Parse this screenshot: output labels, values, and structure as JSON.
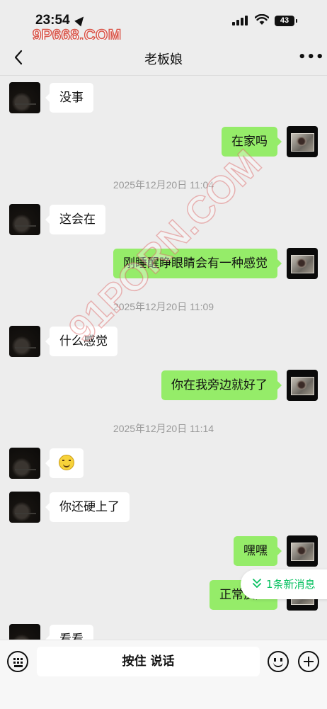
{
  "status_bar": {
    "time": "23:54",
    "battery": "43",
    "watermark": "9P668.COM"
  },
  "header": {
    "title": "老板娘",
    "more_label": "•••"
  },
  "overlay_watermark": "91PORN.COM",
  "messages": [
    {
      "type": "in",
      "text": "没事"
    },
    {
      "type": "out",
      "text": "在家吗"
    },
    {
      "type": "time",
      "text": "2025年12月20日 11:04"
    },
    {
      "type": "in",
      "text": "这会在"
    },
    {
      "type": "out",
      "text": "刚睡醒睁眼睛会有一种感觉"
    },
    {
      "type": "time",
      "text": "2025年12月20日 11:09"
    },
    {
      "type": "in",
      "text": "什么感觉"
    },
    {
      "type": "out",
      "text": "你在我旁边就好了"
    },
    {
      "type": "time",
      "text": "2025年12月20日 11:14"
    },
    {
      "type": "in",
      "emoji": "smile-emoji"
    },
    {
      "type": "in",
      "text": "你还硬上了"
    },
    {
      "type": "out",
      "text": "嘿嘿"
    },
    {
      "type": "out",
      "text": "正常反应"
    },
    {
      "type": "in",
      "text": "看看"
    }
  ],
  "new_messages_pill": {
    "label": "1条新消息"
  },
  "input_bar": {
    "hold_to_talk": "按住 说话"
  },
  "colors": {
    "outgoing_bubble": "#95ec69",
    "incoming_bubble": "#ffffff",
    "background": "#ededed",
    "accent": "#07c160"
  }
}
